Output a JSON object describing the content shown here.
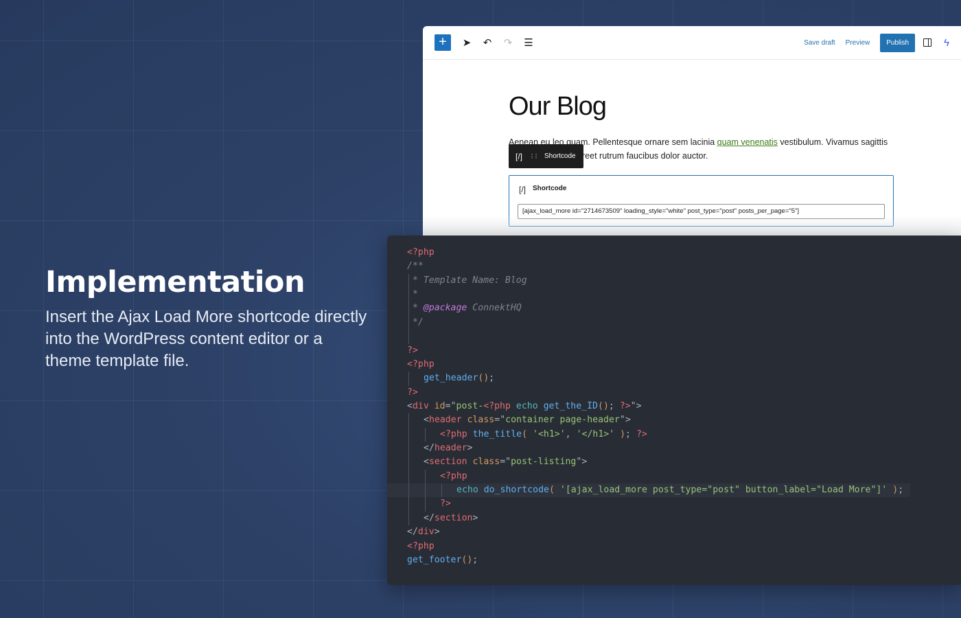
{
  "hero": {
    "title": "Implementation",
    "body": "Insert the Ajax Load More shortcode directly into the WordPress content editor or a theme template file."
  },
  "editor": {
    "toolbar": {
      "add": "+",
      "select_icon": "arrow-pointer-icon",
      "undo_icon": "undo-icon",
      "redo_icon": "redo-icon",
      "list_view_icon": "list-view-icon",
      "save_draft": "Save draft",
      "preview": "Preview",
      "publish": "Publish",
      "settings_icon": "sidebar-toggle-icon",
      "bolt_icon": "lightning-bolt-icon"
    },
    "post_title": "Our Blog",
    "paragraph": {
      "before": "Aenean eu leo quam. Pellentesque ornare sem lacinia ",
      "link": "quam venenatis",
      "after": " vestibulum. Vivamus sagittis lacus vel augue laoreet rutrum faucibus dolor auctor."
    },
    "block_toolbar": {
      "icon": "[/]",
      "drag": "⋮⋮",
      "label": "Shortcode"
    },
    "shortcode_block": {
      "icon": "[/]",
      "label": "Shortcode",
      "value": "[ajax_load_more id=\"2714673509\" loading_style=\"white\" post_type=\"post\" posts_per_page=\"5\"]"
    },
    "colors": {
      "accent": "#2271b1",
      "link": "#3d7a15"
    }
  },
  "code": {
    "lines": [
      {
        "indent": 0,
        "tokens": [
          [
            "php",
            "<?php"
          ]
        ]
      },
      {
        "indent": 0,
        "tokens": [
          [
            "comment",
            "/**"
          ]
        ]
      },
      {
        "indent": 0,
        "guides": [
          0
        ],
        "tokens": [
          [
            "comment",
            " * Template Name: Blog"
          ]
        ]
      },
      {
        "indent": 0,
        "guides": [
          0
        ],
        "tokens": [
          [
            "comment",
            " *"
          ]
        ]
      },
      {
        "indent": 0,
        "guides": [
          0
        ],
        "tokens": [
          [
            "comment",
            " * "
          ],
          [
            "doc",
            "@package"
          ],
          [
            "comment",
            " ConnektHQ"
          ]
        ]
      },
      {
        "indent": 0,
        "guides": [
          0
        ],
        "tokens": [
          [
            "comment",
            " */"
          ]
        ]
      },
      {
        "indent": 0,
        "guides": [
          0
        ],
        "tokens": []
      },
      {
        "indent": 0,
        "tokens": [
          [
            "php",
            "?>"
          ]
        ]
      },
      {
        "indent": 0,
        "tokens": [
          [
            "php",
            "<?php"
          ]
        ]
      },
      {
        "indent": 1,
        "guides": [
          0
        ],
        "tokens": [
          [
            "fn",
            "get_header"
          ],
          [
            "paren",
            "()"
          ],
          [
            "punct",
            ";"
          ]
        ]
      },
      {
        "indent": 0,
        "tokens": [
          [
            "php",
            "?>"
          ]
        ]
      },
      {
        "indent": 0,
        "tokens": [
          [
            "punct",
            "<"
          ],
          [
            "tag",
            "div"
          ],
          [
            "punct",
            " "
          ],
          [
            "attr",
            "id"
          ],
          [
            "punct",
            "=\""
          ],
          [
            "str",
            "post-"
          ],
          [
            "php",
            "<?php"
          ],
          [
            "punct",
            " "
          ],
          [
            "kw",
            "echo"
          ],
          [
            "punct",
            " "
          ],
          [
            "fn",
            "get_the_ID"
          ],
          [
            "paren",
            "()"
          ],
          [
            "punct",
            "; "
          ],
          [
            "php",
            "?>"
          ],
          [
            "punct",
            "\">"
          ]
        ]
      },
      {
        "indent": 1,
        "guides": [
          0
        ],
        "tokens": [
          [
            "punct",
            "<"
          ],
          [
            "tag",
            "header"
          ],
          [
            "punct",
            " "
          ],
          [
            "attr",
            "class"
          ],
          [
            "punct",
            "=\""
          ],
          [
            "str",
            "container page-header"
          ],
          [
            "punct",
            "\">"
          ]
        ]
      },
      {
        "indent": 2,
        "guides": [
          0,
          1
        ],
        "tokens": [
          [
            "php",
            "<?php"
          ],
          [
            "punct",
            " "
          ],
          [
            "fn",
            "the_title"
          ],
          [
            "paren",
            "("
          ],
          [
            "punct",
            " "
          ],
          [
            "str",
            "'<h1>'"
          ],
          [
            "punct",
            ", "
          ],
          [
            "str",
            "'</h1>'"
          ],
          [
            "punct",
            " "
          ],
          [
            "paren",
            ")"
          ],
          [
            "punct",
            "; "
          ],
          [
            "php",
            "?>"
          ]
        ]
      },
      {
        "indent": 1,
        "guides": [
          0
        ],
        "tokens": [
          [
            "punct",
            "</"
          ],
          [
            "tag",
            "header"
          ],
          [
            "punct",
            ">"
          ]
        ]
      },
      {
        "indent": 1,
        "guides": [
          0
        ],
        "tokens": [
          [
            "punct",
            "<"
          ],
          [
            "tag",
            "section"
          ],
          [
            "punct",
            " "
          ],
          [
            "attr",
            "class"
          ],
          [
            "punct",
            "=\""
          ],
          [
            "str",
            "post-listing"
          ],
          [
            "punct",
            "\">"
          ]
        ]
      },
      {
        "indent": 2,
        "guides": [
          0,
          1
        ],
        "tokens": [
          [
            "php",
            "<?php"
          ]
        ]
      },
      {
        "indent": 3,
        "guides": [
          0,
          1,
          2
        ],
        "highlight": true,
        "tokens": [
          [
            "kw",
            "echo"
          ],
          [
            "punct",
            " "
          ],
          [
            "fn",
            "do_shortcode"
          ],
          [
            "paren",
            "("
          ],
          [
            "punct",
            " "
          ],
          [
            "str",
            "'[ajax_load_more post_type=\"post\" button_label=\"Load More\"]'"
          ],
          [
            "punct",
            " "
          ],
          [
            "paren",
            ")"
          ],
          [
            "punct",
            ";"
          ]
        ]
      },
      {
        "indent": 2,
        "guides": [
          0,
          1
        ],
        "tokens": [
          [
            "php",
            "?>"
          ]
        ]
      },
      {
        "indent": 1,
        "guides": [
          0
        ],
        "tokens": [
          [
            "punct",
            "</"
          ],
          [
            "tag",
            "section"
          ],
          [
            "punct",
            ">"
          ]
        ]
      },
      {
        "indent": 0,
        "tokens": [
          [
            "punct",
            "</"
          ],
          [
            "tag",
            "div"
          ],
          [
            "punct",
            ">"
          ]
        ]
      },
      {
        "indent": 0,
        "tokens": [
          [
            "php",
            "<?php"
          ]
        ]
      },
      {
        "indent": 0,
        "tokens": [
          [
            "fn",
            "get_footer"
          ],
          [
            "paren",
            "()"
          ],
          [
            "punct",
            ";"
          ]
        ]
      }
    ]
  }
}
